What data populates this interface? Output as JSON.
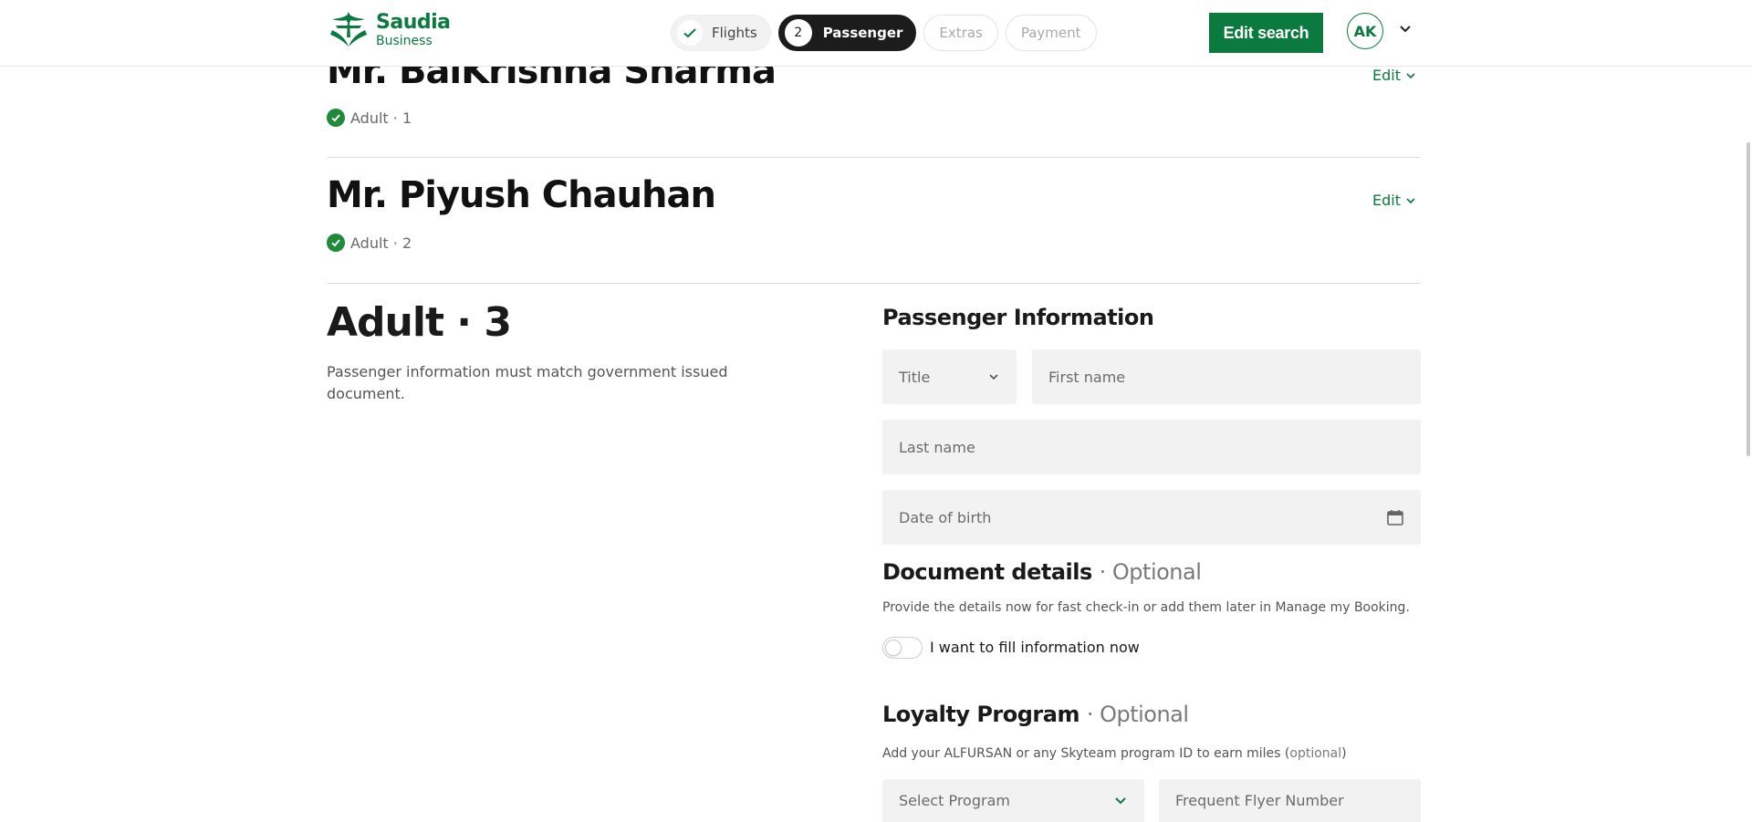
{
  "header": {
    "logo": {
      "brand": "Saudia",
      "sub": "Business"
    },
    "steps": [
      {
        "label": "Flights",
        "state": "done"
      },
      {
        "number": "2",
        "label": "Passenger",
        "state": "active"
      },
      {
        "label": "Extras",
        "state": "disabled"
      },
      {
        "label": "Payment",
        "state": "disabled"
      }
    ],
    "edit_search_label": "Edit search",
    "avatar_initials": "AK"
  },
  "passengers": [
    {
      "name": "Mr. BalKrishna Sharma",
      "type": "Adult",
      "index": "· 1",
      "edit_label": "Edit"
    },
    {
      "name": "Mr. Piyush Chauhan",
      "type": "Adult",
      "index": "· 2",
      "edit_label": "Edit"
    }
  ],
  "current": {
    "title": "Adult · 3",
    "note": "Passenger information must match government issued document."
  },
  "form": {
    "section_title": "Passenger Information",
    "title_placeholder": "Title",
    "first_name_placeholder": "First name",
    "last_name_placeholder": "Last name",
    "dob_placeholder": "Date of birth",
    "document": {
      "title": "Document details",
      "optional": "· Optional",
      "help": "Provide the details now for fast check-in or add them later in Manage my Booking.",
      "toggle_label": "I want to fill information now",
      "toggle_on": false
    },
    "loyalty": {
      "title": "Loyalty Program",
      "optional": "· Optional",
      "help_prefix": "Add your ALFURSAN or any Skyteam program ID to earn miles (",
      "help_optional": "optional",
      "help_suffix": ")",
      "program_placeholder": "Select Program",
      "ffn_placeholder": "Frequent Flyer Number"
    }
  },
  "colors": {
    "brand_green": "#0b7a3e",
    "check_green": "#1f8a3b",
    "active_step": "#1c1c1c",
    "field_bg": "#f2f2f2"
  }
}
